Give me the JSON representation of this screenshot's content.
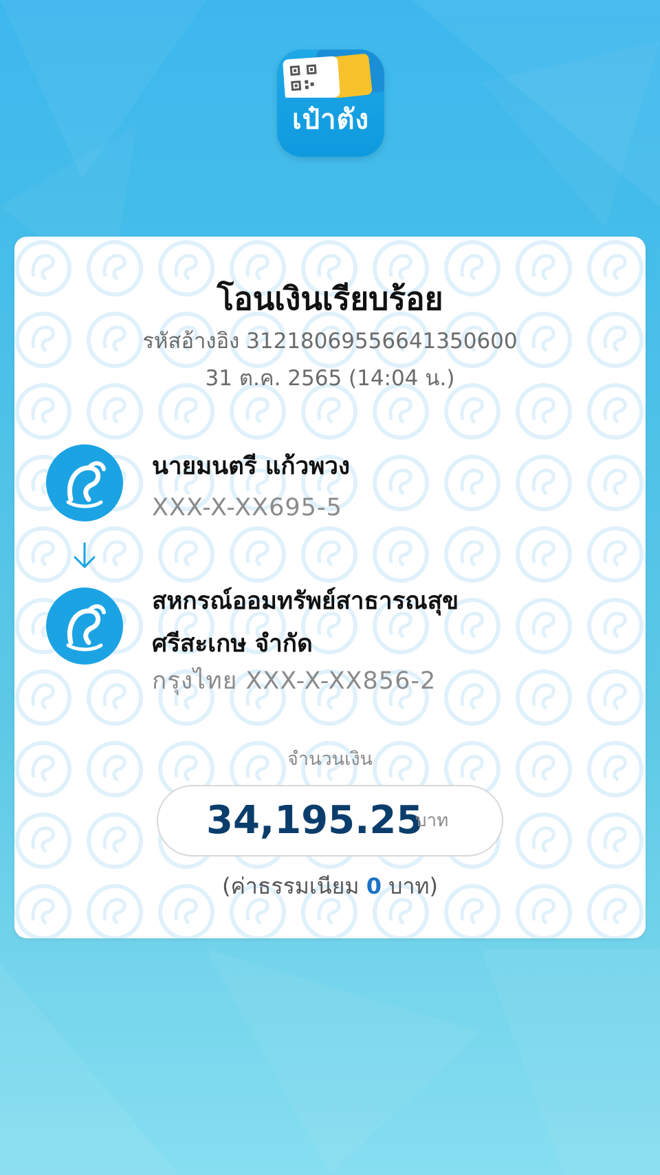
{
  "app_icon": {
    "label": "เป๋าตัง"
  },
  "receipt": {
    "title": "โอนเงินเรียบร้อย",
    "reference": "รหัสอ้างอิง 31218069556641350600",
    "datetime": "31 ต.ค. 2565 (14:04 น.)",
    "sender": {
      "name": "นายมนตรี แก้วพวง",
      "account": "XXX-X-XX695-5",
      "bank_icon": "krungthai-logo-icon"
    },
    "recipient": {
      "name_line1": "สหกรณ์ออมทรัพย์สาธารณสุข",
      "name_line2": "ศรีสะเกษ จำกัด",
      "account": "กรุงไทย XXX-X-XX856-2",
      "bank_icon": "krungthai-logo-icon"
    },
    "amount_label": "จำนวนเงิน",
    "amount": "34,195.25",
    "amount_unit": "บาท",
    "fee_prefix": "(ค่าธรรมเนียม ",
    "fee_value": "0",
    "fee_suffix": " บาท)"
  },
  "colors": {
    "background_top": "#3db7ee",
    "background_bottom": "#86def0",
    "bank_blue": "#1ba3e3",
    "amount_text": "#0a3d6b",
    "fee_number": "#1b73c9"
  }
}
